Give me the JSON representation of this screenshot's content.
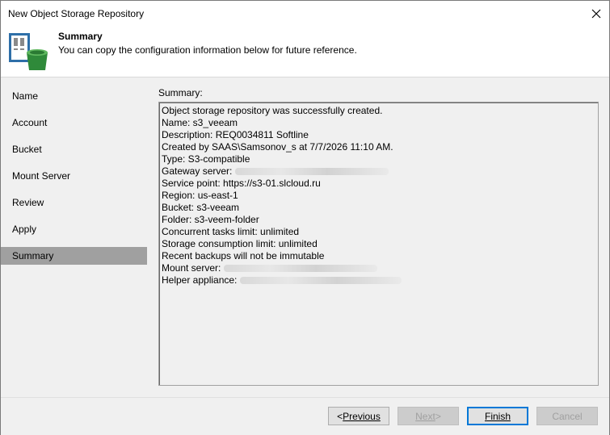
{
  "window": {
    "title": "New Object Storage Repository"
  },
  "header": {
    "title": "Summary",
    "subtitle": "You can copy the configuration information below for future reference."
  },
  "nav": {
    "items": [
      {
        "label": "Name"
      },
      {
        "label": "Account"
      },
      {
        "label": "Bucket"
      },
      {
        "label": "Mount Server"
      },
      {
        "label": "Review"
      },
      {
        "label": "Apply"
      },
      {
        "label": "Summary",
        "active": true
      }
    ]
  },
  "summary": {
    "label": "Summary:",
    "lines": [
      "Object storage repository was successfully created.",
      "Name: s3_veeam",
      "Description: REQ0034811 Softline",
      "Created by SAAS\\Samsonov_s at 7/7/2026 11:10 AM.",
      "Type: S3-compatible",
      "Gateway server:",
      "Service point: https://s3-01.slcloud.ru",
      "Region: us-east-1",
      "Bucket: s3-veeam",
      "Folder: s3-veem-folder",
      "Concurrent tasks limit: unlimited",
      "Storage consumption limit: unlimited",
      "Recent backups will not be immutable",
      "Mount server:",
      "Helper appliance:"
    ]
  },
  "footer": {
    "previous_prefix": "< ",
    "previous_label": "Previous",
    "next_label": "Next",
    "next_suffix": " >",
    "finish_label": "Finish",
    "cancel_label": "Cancel"
  },
  "colors": {
    "nav_active": "#a0a0a0",
    "panel_bg": "#f0f0f0",
    "primary_border": "#0078d7"
  }
}
